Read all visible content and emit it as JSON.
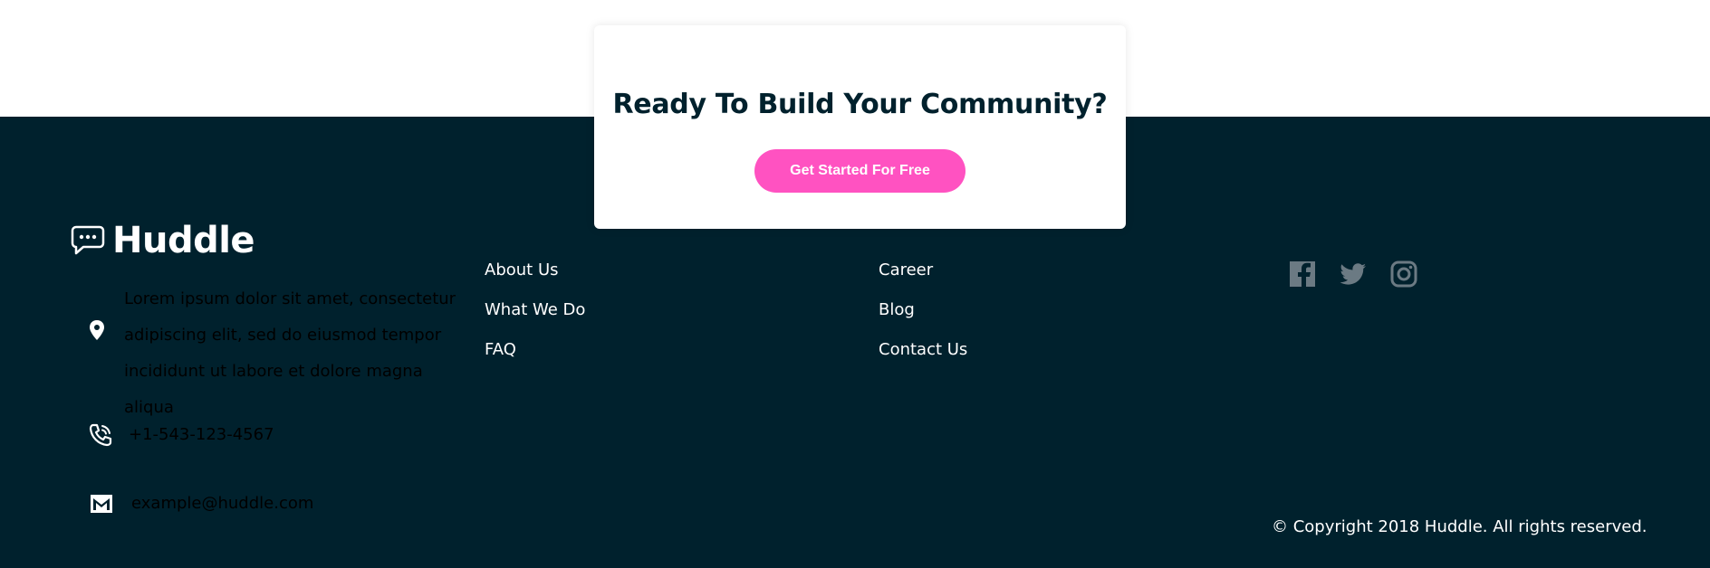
{
  "cta": {
    "title": "Ready To Build Your Community?",
    "button_label": "Get Started For Free"
  },
  "brand": {
    "name": "Huddle",
    "icon": "chat-bubble-icon"
  },
  "contact": {
    "address": "Lorem ipsum dolor sit amet, consectetur adipiscing elit, sed do eiusmod tempor incididunt ut labore et dolore magna aliqua",
    "phone": "+1-543-123-4567",
    "email": "example@huddle.com"
  },
  "nav": {
    "column1": [
      "About Us",
      "What We Do",
      "FAQ"
    ],
    "column2": [
      "Career",
      "Blog",
      "Contact Us"
    ]
  },
  "social": [
    "facebook-icon",
    "twitter-icon",
    "instagram-icon"
  ],
  "copyright": "© Copyright 2018 Huddle. All rights reserved.",
  "colors": {
    "footer_bg": "#00212d",
    "accent": "#ff52c1",
    "social_icon": "#6b7a83",
    "text_light": "#ffffff"
  }
}
